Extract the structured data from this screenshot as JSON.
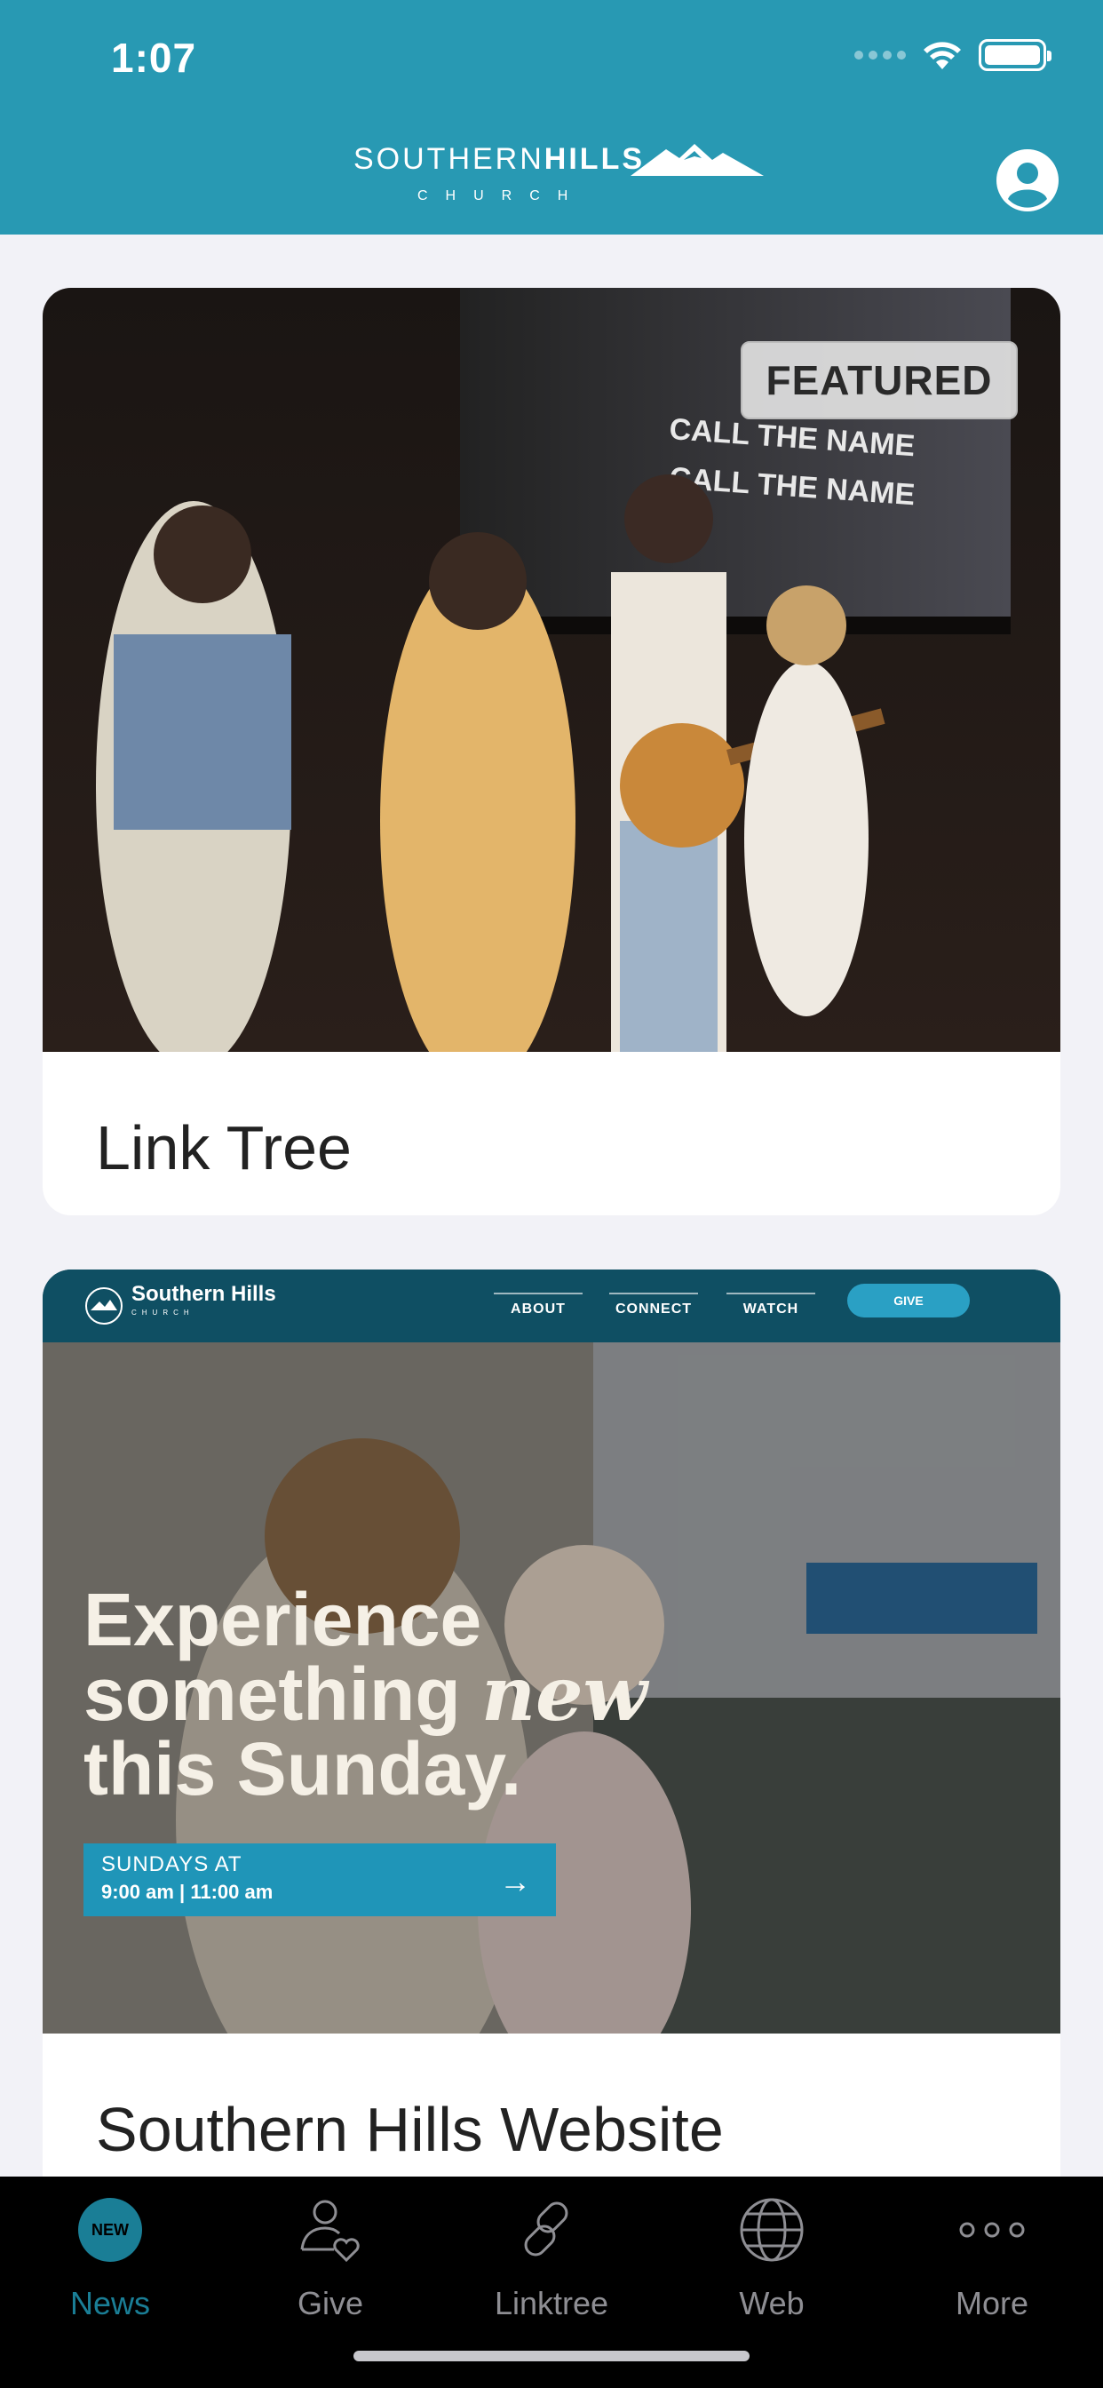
{
  "status_bar": {
    "time": "1:07"
  },
  "header": {
    "logo_primary": "SOUTHERN",
    "logo_bold": "HILLS",
    "logo_secondary": "CHURCH"
  },
  "feed": [
    {
      "title": "Link Tree",
      "badge": "FEATURED"
    },
    {
      "title": "Southern Hills Website",
      "site_brand": "Southern Hills",
      "site_brand_sub": "CHURCH",
      "site_nav": [
        "ABOUT",
        "CONNECT",
        "WATCH"
      ],
      "site_give": "GIVE",
      "headline_1": "Experience",
      "headline_2a": "something",
      "headline_2b": "new",
      "headline_3": "this Sunday.",
      "times_label": "SUNDAYS AT",
      "times_value": "9:00 am | 11:00 am"
    }
  ],
  "tabs": [
    {
      "label": "News",
      "badge": "NEW",
      "icon": "new-badge-icon",
      "active": true
    },
    {
      "label": "Give",
      "icon": "person-heart-icon"
    },
    {
      "label": "Linktree",
      "icon": "link-icon"
    },
    {
      "label": "Web",
      "icon": "globe-icon"
    },
    {
      "label": "More",
      "icon": "more-dots-icon"
    }
  ],
  "colors": {
    "header": "#2899b3",
    "accent": "#1a7e96",
    "tabbar": "#000000"
  }
}
